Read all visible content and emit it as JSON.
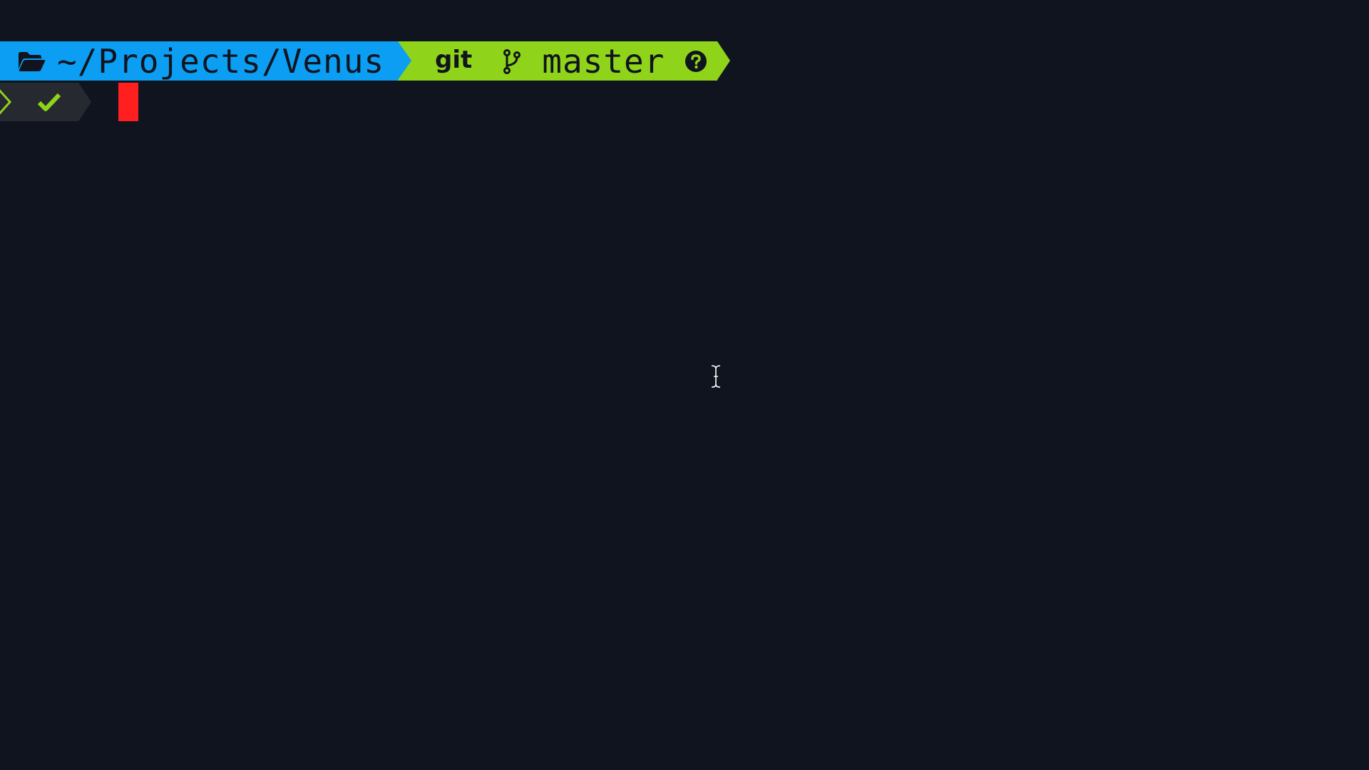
{
  "prompt": {
    "directory": "~/Projects/Venus",
    "vcs_label": "git",
    "branch": "master"
  },
  "icons": {
    "directory": "folder-open-icon",
    "branch": "git-branch-icon",
    "vcs_status": "question-circle-icon",
    "exit_status": "checkmark-icon",
    "line_start": "chevron-right-icon",
    "mouse_pointer": "text-cursor-icon"
  },
  "colors": {
    "background": "#10141e",
    "dir_segment": "#0c9ef2",
    "git_segment": "#8fd31a",
    "status_segment": "#262a30",
    "success_check": "#8fd31a",
    "cursor": "#ff1f1f"
  }
}
